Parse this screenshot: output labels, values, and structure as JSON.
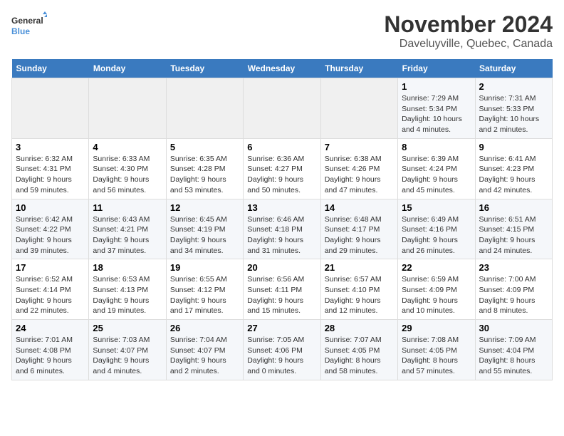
{
  "header": {
    "logo_general": "General",
    "logo_blue": "Blue",
    "title": "November 2024",
    "subtitle": "Daveluyville, Quebec, Canada"
  },
  "weekdays": [
    "Sunday",
    "Monday",
    "Tuesday",
    "Wednesday",
    "Thursday",
    "Friday",
    "Saturday"
  ],
  "weeks": [
    [
      {
        "day": "",
        "info": ""
      },
      {
        "day": "",
        "info": ""
      },
      {
        "day": "",
        "info": ""
      },
      {
        "day": "",
        "info": ""
      },
      {
        "day": "",
        "info": ""
      },
      {
        "day": "1",
        "info": "Sunrise: 7:29 AM\nSunset: 5:34 PM\nDaylight: 10 hours and 4 minutes."
      },
      {
        "day": "2",
        "info": "Sunrise: 7:31 AM\nSunset: 5:33 PM\nDaylight: 10 hours and 2 minutes."
      }
    ],
    [
      {
        "day": "3",
        "info": "Sunrise: 6:32 AM\nSunset: 4:31 PM\nDaylight: 9 hours and 59 minutes."
      },
      {
        "day": "4",
        "info": "Sunrise: 6:33 AM\nSunset: 4:30 PM\nDaylight: 9 hours and 56 minutes."
      },
      {
        "day": "5",
        "info": "Sunrise: 6:35 AM\nSunset: 4:28 PM\nDaylight: 9 hours and 53 minutes."
      },
      {
        "day": "6",
        "info": "Sunrise: 6:36 AM\nSunset: 4:27 PM\nDaylight: 9 hours and 50 minutes."
      },
      {
        "day": "7",
        "info": "Sunrise: 6:38 AM\nSunset: 4:26 PM\nDaylight: 9 hours and 47 minutes."
      },
      {
        "day": "8",
        "info": "Sunrise: 6:39 AM\nSunset: 4:24 PM\nDaylight: 9 hours and 45 minutes."
      },
      {
        "day": "9",
        "info": "Sunrise: 6:41 AM\nSunset: 4:23 PM\nDaylight: 9 hours and 42 minutes."
      }
    ],
    [
      {
        "day": "10",
        "info": "Sunrise: 6:42 AM\nSunset: 4:22 PM\nDaylight: 9 hours and 39 minutes."
      },
      {
        "day": "11",
        "info": "Sunrise: 6:43 AM\nSunset: 4:21 PM\nDaylight: 9 hours and 37 minutes."
      },
      {
        "day": "12",
        "info": "Sunrise: 6:45 AM\nSunset: 4:19 PM\nDaylight: 9 hours and 34 minutes."
      },
      {
        "day": "13",
        "info": "Sunrise: 6:46 AM\nSunset: 4:18 PM\nDaylight: 9 hours and 31 minutes."
      },
      {
        "day": "14",
        "info": "Sunrise: 6:48 AM\nSunset: 4:17 PM\nDaylight: 9 hours and 29 minutes."
      },
      {
        "day": "15",
        "info": "Sunrise: 6:49 AM\nSunset: 4:16 PM\nDaylight: 9 hours and 26 minutes."
      },
      {
        "day": "16",
        "info": "Sunrise: 6:51 AM\nSunset: 4:15 PM\nDaylight: 9 hours and 24 minutes."
      }
    ],
    [
      {
        "day": "17",
        "info": "Sunrise: 6:52 AM\nSunset: 4:14 PM\nDaylight: 9 hours and 22 minutes."
      },
      {
        "day": "18",
        "info": "Sunrise: 6:53 AM\nSunset: 4:13 PM\nDaylight: 9 hours and 19 minutes."
      },
      {
        "day": "19",
        "info": "Sunrise: 6:55 AM\nSunset: 4:12 PM\nDaylight: 9 hours and 17 minutes."
      },
      {
        "day": "20",
        "info": "Sunrise: 6:56 AM\nSunset: 4:11 PM\nDaylight: 9 hours and 15 minutes."
      },
      {
        "day": "21",
        "info": "Sunrise: 6:57 AM\nSunset: 4:10 PM\nDaylight: 9 hours and 12 minutes."
      },
      {
        "day": "22",
        "info": "Sunrise: 6:59 AM\nSunset: 4:09 PM\nDaylight: 9 hours and 10 minutes."
      },
      {
        "day": "23",
        "info": "Sunrise: 7:00 AM\nSunset: 4:09 PM\nDaylight: 9 hours and 8 minutes."
      }
    ],
    [
      {
        "day": "24",
        "info": "Sunrise: 7:01 AM\nSunset: 4:08 PM\nDaylight: 9 hours and 6 minutes."
      },
      {
        "day": "25",
        "info": "Sunrise: 7:03 AM\nSunset: 4:07 PM\nDaylight: 9 hours and 4 minutes."
      },
      {
        "day": "26",
        "info": "Sunrise: 7:04 AM\nSunset: 4:07 PM\nDaylight: 9 hours and 2 minutes."
      },
      {
        "day": "27",
        "info": "Sunrise: 7:05 AM\nSunset: 4:06 PM\nDaylight: 9 hours and 0 minutes."
      },
      {
        "day": "28",
        "info": "Sunrise: 7:07 AM\nSunset: 4:05 PM\nDaylight: 8 hours and 58 minutes."
      },
      {
        "day": "29",
        "info": "Sunrise: 7:08 AM\nSunset: 4:05 PM\nDaylight: 8 hours and 57 minutes."
      },
      {
        "day": "30",
        "info": "Sunrise: 7:09 AM\nSunset: 4:04 PM\nDaylight: 8 hours and 55 minutes."
      }
    ]
  ]
}
